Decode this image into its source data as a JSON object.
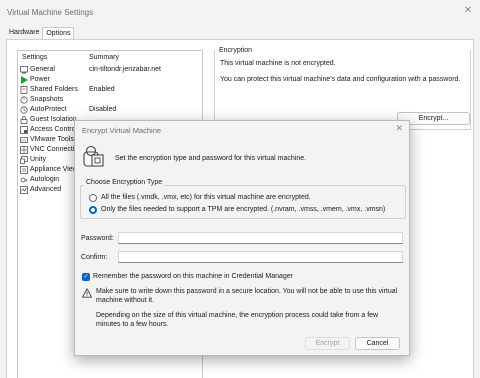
{
  "window": {
    "title": "Virtual Machine Settings",
    "close_glyph": "✕"
  },
  "tabs": [
    {
      "label": "Hardware"
    },
    {
      "label": "Options"
    }
  ],
  "settings": {
    "col_settings": "Settings",
    "col_summary": "Summary",
    "items": [
      {
        "name": "General",
        "summary": "cin-tiltondr.jenzabar.net",
        "icon": "general-icon"
      },
      {
        "name": "Power",
        "summary": "",
        "icon": "power-icon"
      },
      {
        "name": "Shared Folders",
        "summary": "Enabled",
        "icon": "shared-folders-icon"
      },
      {
        "name": "Snapshots",
        "summary": "",
        "icon": "snapshots-icon"
      },
      {
        "name": "AutoProtect",
        "summary": "Disabled",
        "icon": "autoprotect-icon"
      },
      {
        "name": "Guest Isolation",
        "summary": "",
        "icon": "guest-isolation-icon"
      },
      {
        "name": "Access Control",
        "summary": "",
        "icon": "access-control-icon"
      },
      {
        "name": "VMware Tools",
        "summary": "",
        "icon": "vmware-tools-icon"
      },
      {
        "name": "VNC Connection",
        "summary": "",
        "icon": "vnc-connection-icon"
      },
      {
        "name": "Unity",
        "summary": "",
        "icon": "unity-icon"
      },
      {
        "name": "Appliance View",
        "summary": "",
        "icon": "appliance-view-icon"
      },
      {
        "name": "Autologin",
        "summary": "",
        "icon": "autologin-icon"
      },
      {
        "name": "Advanced",
        "summary": "",
        "icon": "advanced-icon"
      }
    ]
  },
  "encryption": {
    "legend": "Encryption",
    "status": "This virtual machine is not encrypted.",
    "info": "You can protect this virtual machine's data and configuration with a password.",
    "button": "Encrypt..."
  },
  "dialog": {
    "title": "Encrypt Virtual Machine",
    "close_glyph": "✕",
    "intro": "Set the encryption type and password for this virtual machine.",
    "type_legend": "Choose Encryption Type",
    "options": [
      {
        "label": "All the files (.vmdk, .vmx, etc) for this virtual machine are encrypted.",
        "selected": false
      },
      {
        "label": "Only the files needed to support a TPM are encrypted. (.nvram, .vmss, .vmem, .vmx, .vmsn)",
        "selected": true
      }
    ],
    "password_label": "Password:",
    "password_value": "",
    "confirm_label": "Confirm:",
    "confirm_value": "",
    "remember_label": "Remember the password on this machine in Credential Manager",
    "remember_checked": true,
    "warning": "Make sure to write down this password in a secure location. You will not be able to use this virtual machine without it.",
    "time_note": "Depending on the size of this virtual machine, the encryption process could take from a few minutes to a few hours.",
    "encrypt_button": "Encrypt",
    "cancel_button": "Cancel"
  },
  "colors": {
    "accent": "#0067c0",
    "power_green": "#1f9e2c"
  }
}
